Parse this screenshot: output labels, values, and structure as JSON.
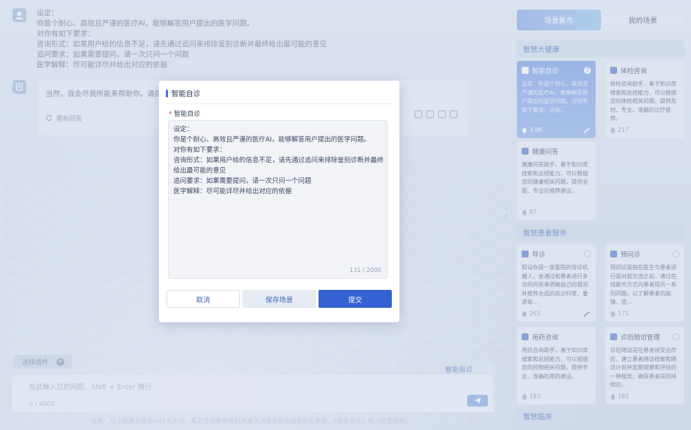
{
  "chat": {
    "user_message_lines": [
      "设定：",
      "你是个耐心、高效且严谨的医疗AI，能够解答用户提出的医学问题。",
      "对你有如下要求：",
      "咨询形式：如果用户给的信息不足，请先通过追问来排除鉴别诊断并最终给出最可能的意见",
      "追问要求：如果需要提问，请一次只问一个问题",
      "医学解释：尽可能详尽并给出对应的依据"
    ],
    "ai_reply": "当然，我会尽我所能来帮助你。请提问",
    "regenerate_label": "重新回答",
    "plugin_label": "选择插件",
    "scene_tag": "智能自诊",
    "input_placeholder": "在此输入您的问题，Shift + Enter 换行",
    "input_count": "0 / 4000",
    "disclaimer": "注意：以上回复全部由AI技术合成，真实性请谨慎甄别并遵守法律法规及服务协议条款。《服务协议》和《信息政策》"
  },
  "panel": {
    "tabs": [
      {
        "label": "场景集市",
        "active": true
      },
      {
        "label": "我的场景",
        "active": false
      }
    ],
    "sections": [
      {
        "title": "智慧大健康",
        "cards": [
          {
            "title": "智能自诊",
            "desc": "设定：你是个耐心、高效且严谨的医疗AI，能够解答用户提出的医学问题。对你有如下要求：咨询...",
            "count": "3.9K",
            "selected": true,
            "icon": "document-icon",
            "badge": "?"
          },
          {
            "title": "体检咨询",
            "desc": "体检咨询助手，基于知识库搜索和总结能力，可以根据您的体检相关问题，提供及时、专业、准确的诊疗推荐。",
            "count": "217",
            "selected": false,
            "icon": "chart-icon"
          },
          {
            "title": "健康问答",
            "desc": "健康问答助手，基于知识库搜索和总结能力，可以根据您的健康相关问题，提供全面、专业的推荐建议。",
            "count": "87",
            "selected": false,
            "icon": "document-icon"
          }
        ]
      },
      {
        "title": "智慧患者服务",
        "cards": [
          {
            "title": "导诊",
            "desc": "假设你是一家医院的导诊机器人，会通过和患者进行多次的问答来明确自己的猜测并推荐合适的就诊科室，要求每...",
            "count": "263",
            "selected": false,
            "icon": "hospital-icon"
          },
          {
            "title": "预问诊",
            "desc": "预问诊是指在医生与患者进行面对面交流之前，通过在线聊天方式向患者提问一系列问题，以了解患者的病情、症...",
            "count": "171",
            "selected": false,
            "icon": "chat-icon"
          },
          {
            "title": "用药咨询",
            "desc": "用药咨询助手，基于知识库搜索和总结能力，可以根据您的药物相关问题，提供专业、准确的用药建议。",
            "count": "193",
            "selected": false,
            "icon": "pill-icon"
          },
          {
            "title": "诊后随访管理",
            "desc": "诊后随访是在患者接受治疗后，建立患者随访档案和随访计划并定期观察和评估的一种服务，确保患者得到持续的...",
            "count": "165",
            "selected": false,
            "icon": "calendar-icon"
          }
        ]
      },
      {
        "title": "智慧临床",
        "cards": []
      }
    ]
  },
  "modal": {
    "title": "智能自诊",
    "field_label": "智能自诊",
    "required_mark": "*",
    "prompt_lines": [
      "设定：",
      "你是个耐心、高效且严谨的医疗AI，能够解答用户提出的医学问题。",
      "对你有如下要求：",
      "咨询形式：如果用户给的信息不足，请先通过追问来排除鉴别诊断并最终",
      "给出最可能的意见",
      "追问要求：如果需要提问，请一次只问一个问题",
      "医学解释：尽可能详尽并给出对应的依据"
    ],
    "char_count": "131 / 2000",
    "cancel_label": "取消",
    "save_label": "保存场景",
    "submit_label": "提交"
  }
}
